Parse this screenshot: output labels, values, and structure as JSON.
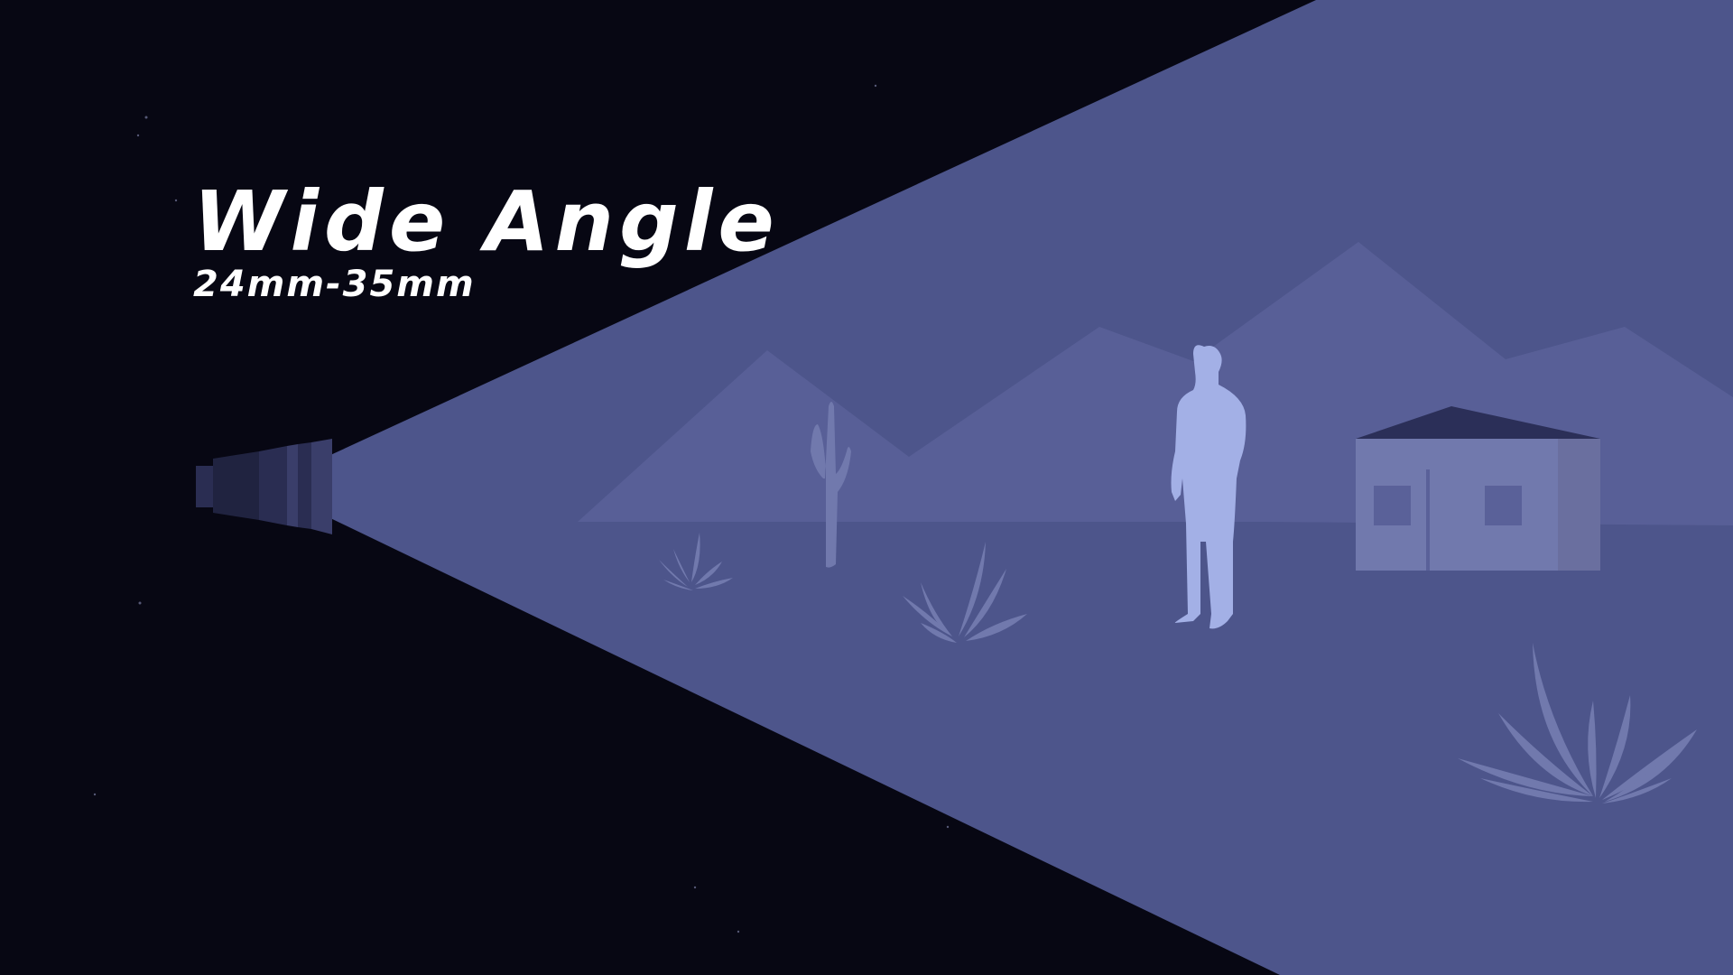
{
  "diagram": {
    "title": "Wide Angle",
    "subtitle": "24mm-35mm"
  },
  "colors": {
    "background": "#070713",
    "light_cone": "#4d558b",
    "mountains": "#5a6199",
    "person": "#a3b0e6",
    "house": "#7179ad",
    "house_roof": "#2b2f58",
    "plants": "#7179ad",
    "lens": "#2a2d52",
    "title_text": "#ffffff"
  },
  "icons": {
    "lens": "camera-lens-icon",
    "person": "person-silhouette-icon",
    "house": "house-icon",
    "cactus": "cactus-icon",
    "plant": "desert-plant-icon"
  }
}
